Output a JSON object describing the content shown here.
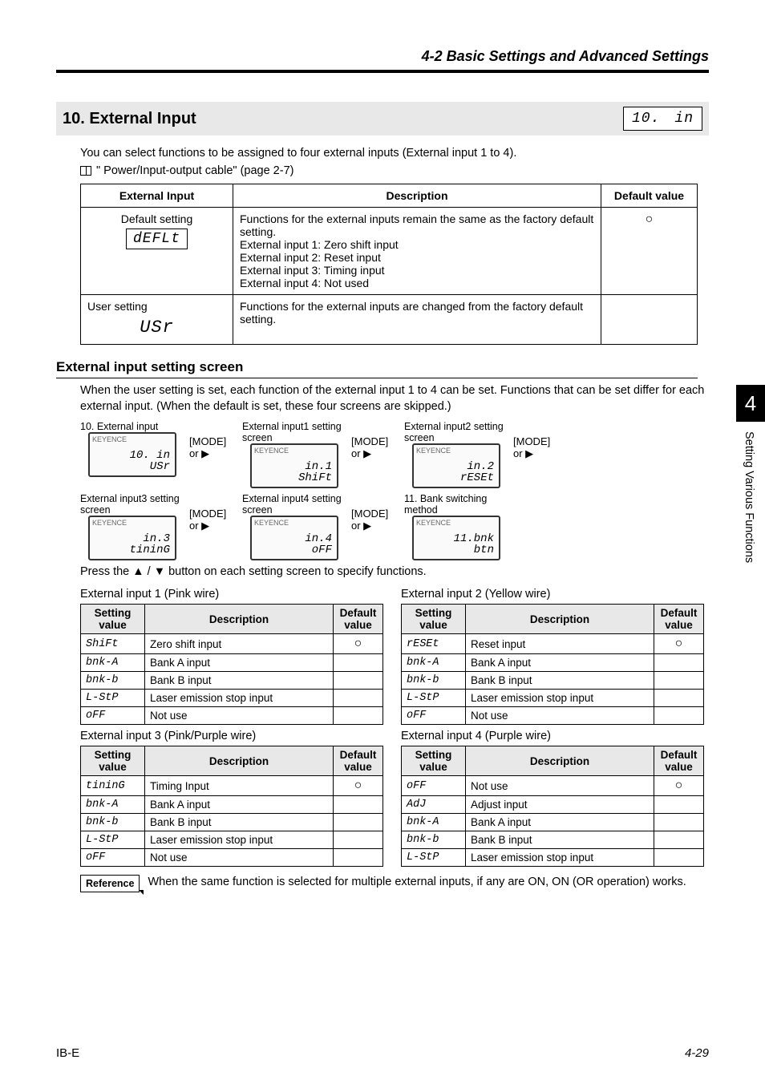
{
  "header": {
    "title": "4-2 Basic Settings and Advanced Settings"
  },
  "section": {
    "number_title": "10. External Input",
    "badge_left": "10.",
    "badge_right": "in",
    "intro": "You can select functions to be assigned to four external inputs (External input 1 to 4).",
    "book_ref": "\" Power/Input-output cable\" (page 2-7)"
  },
  "maintable": {
    "headers": {
      "c1": "External Input",
      "c2": "Description",
      "c3": "Default value"
    },
    "rows": [
      {
        "label": "Default setting",
        "seg": "dEFLt",
        "desc": "Functions for the external inputs remain the same as the factory default setting.\nExternal input 1: Zero shift input\nExternal input 2: Reset input\nExternal input 3: Timing input\nExternal input 4: Not used",
        "def": "○"
      },
      {
        "label": "User setting",
        "seg": "USr",
        "desc": "Functions for the external inputs are changed from the factory default setting.",
        "def": ""
      }
    ]
  },
  "subsection": {
    "heading": "External input setting screen",
    "text": "When the user setting is set, each function of the external input 1 to 4 can be set. Functions that can be set differ for each external input. (When the default is set, these four screens are skipped.)",
    "press": "Press the ▲ / ▼ button on each setting screen to specify functions."
  },
  "flow": {
    "mode": "[MODE]\nor ▶",
    "items": [
      {
        "label": "10. External input",
        "seg1": "10.  in",
        "seg2": "USr"
      },
      {
        "label": "External input1 setting screen",
        "seg1": "in.1",
        "seg2": "ShiFt"
      },
      {
        "label": "External input2 setting screen",
        "seg1": "in.2",
        "seg2": "rESEt"
      },
      {
        "label": "External input3 setting screen",
        "seg1": "in.3",
        "seg2": "tininG"
      },
      {
        "label": "External input4 setting screen",
        "seg1": "in.4",
        "seg2": "oFF"
      },
      {
        "label": "11. Bank switching method",
        "seg1": "11.bnk",
        "seg2": "btn"
      }
    ]
  },
  "input_tables": {
    "in1": {
      "caption": "External input 1 (Pink wire)",
      "rows": [
        {
          "sv": "ShiFt",
          "desc": "Zero shift input",
          "def": "○"
        },
        {
          "sv": "bnk-A",
          "desc": "Bank A input",
          "def": ""
        },
        {
          "sv": "bnk-b",
          "desc": "Bank B input",
          "def": ""
        },
        {
          "sv": "L-StP",
          "desc": "Laser emission stop input",
          "def": ""
        },
        {
          "sv": "oFF",
          "desc": "Not use",
          "def": ""
        }
      ]
    },
    "in2": {
      "caption": "External input 2 (Yellow wire)",
      "rows": [
        {
          "sv": "rESEt",
          "desc": "Reset input",
          "def": "○"
        },
        {
          "sv": "bnk-A",
          "desc": "Bank A input",
          "def": ""
        },
        {
          "sv": "bnk-b",
          "desc": "Bank B input",
          "def": ""
        },
        {
          "sv": "L-StP",
          "desc": "Laser emission stop input",
          "def": ""
        },
        {
          "sv": "oFF",
          "desc": "Not use",
          "def": ""
        }
      ]
    },
    "in3": {
      "caption": "External input 3 (Pink/Purple wire)",
      "rows": [
        {
          "sv": "tininG",
          "desc": "Timing Input",
          "def": "○"
        },
        {
          "sv": "bnk-A",
          "desc": "Bank A input",
          "def": ""
        },
        {
          "sv": "bnk-b",
          "desc": "Bank B input",
          "def": ""
        },
        {
          "sv": "L-StP",
          "desc": "Laser emission stop input",
          "def": ""
        },
        {
          "sv": "oFF",
          "desc": "Not use",
          "def": ""
        }
      ]
    },
    "in4": {
      "caption": "External input 4 (Purple wire)",
      "rows": [
        {
          "sv": "oFF",
          "desc": "Not use",
          "def": "○"
        },
        {
          "sv": "AdJ",
          "desc": "Adjust input",
          "def": ""
        },
        {
          "sv": "bnk-A",
          "desc": "Bank A input",
          "def": ""
        },
        {
          "sv": "bnk-b",
          "desc": "Bank B input",
          "def": ""
        },
        {
          "sv": "L-StP",
          "desc": "Laser emission stop input",
          "def": ""
        }
      ]
    },
    "headers": {
      "sv": "Setting value",
      "desc": "Description",
      "def": "Default value"
    }
  },
  "reference": {
    "label": "Reference",
    "text": "When the same function is selected for multiple external inputs, if any are ON, ON (OR operation) works."
  },
  "footer": {
    "doc": "IB-E",
    "page": "4-29"
  },
  "sidetab": {
    "num": "4",
    "text": "Setting Various Functions"
  }
}
